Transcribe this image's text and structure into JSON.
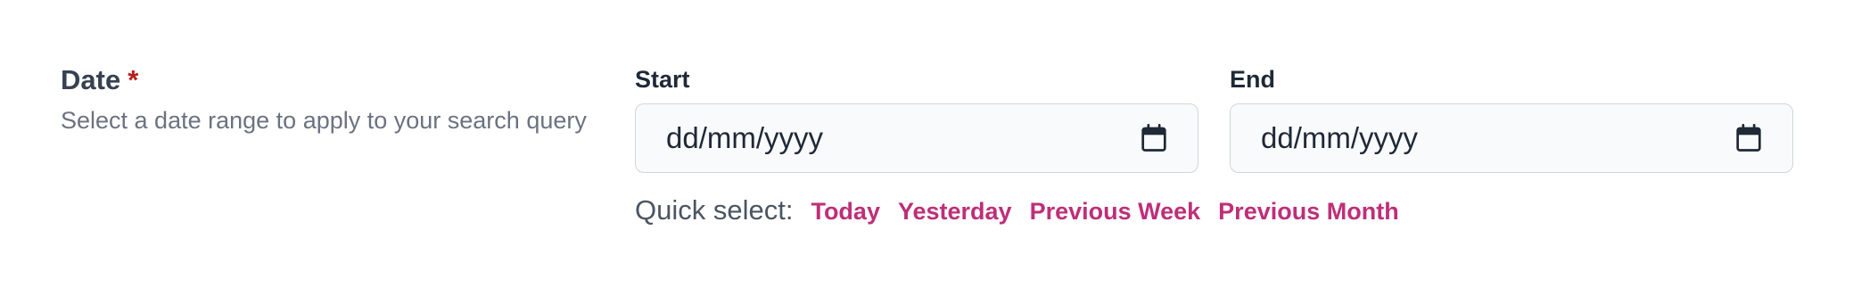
{
  "field": {
    "label": "Date",
    "required_marker": "*",
    "description": "Select a date range to apply to your search query"
  },
  "start": {
    "label": "Start",
    "placeholder": "dd/mm/yyyy",
    "icon": "calendar-icon"
  },
  "end": {
    "label": "End",
    "placeholder": "dd/mm/yyyy",
    "icon": "calendar-icon"
  },
  "quick_select": {
    "label": "Quick select:",
    "options": [
      "Today",
      "Yesterday",
      "Previous Week",
      "Previous Month"
    ]
  },
  "colors": {
    "accent": "#be2f78",
    "required": "#b91c1c",
    "input_bg": "#f9fafb",
    "input_border": "#d1d5db"
  }
}
